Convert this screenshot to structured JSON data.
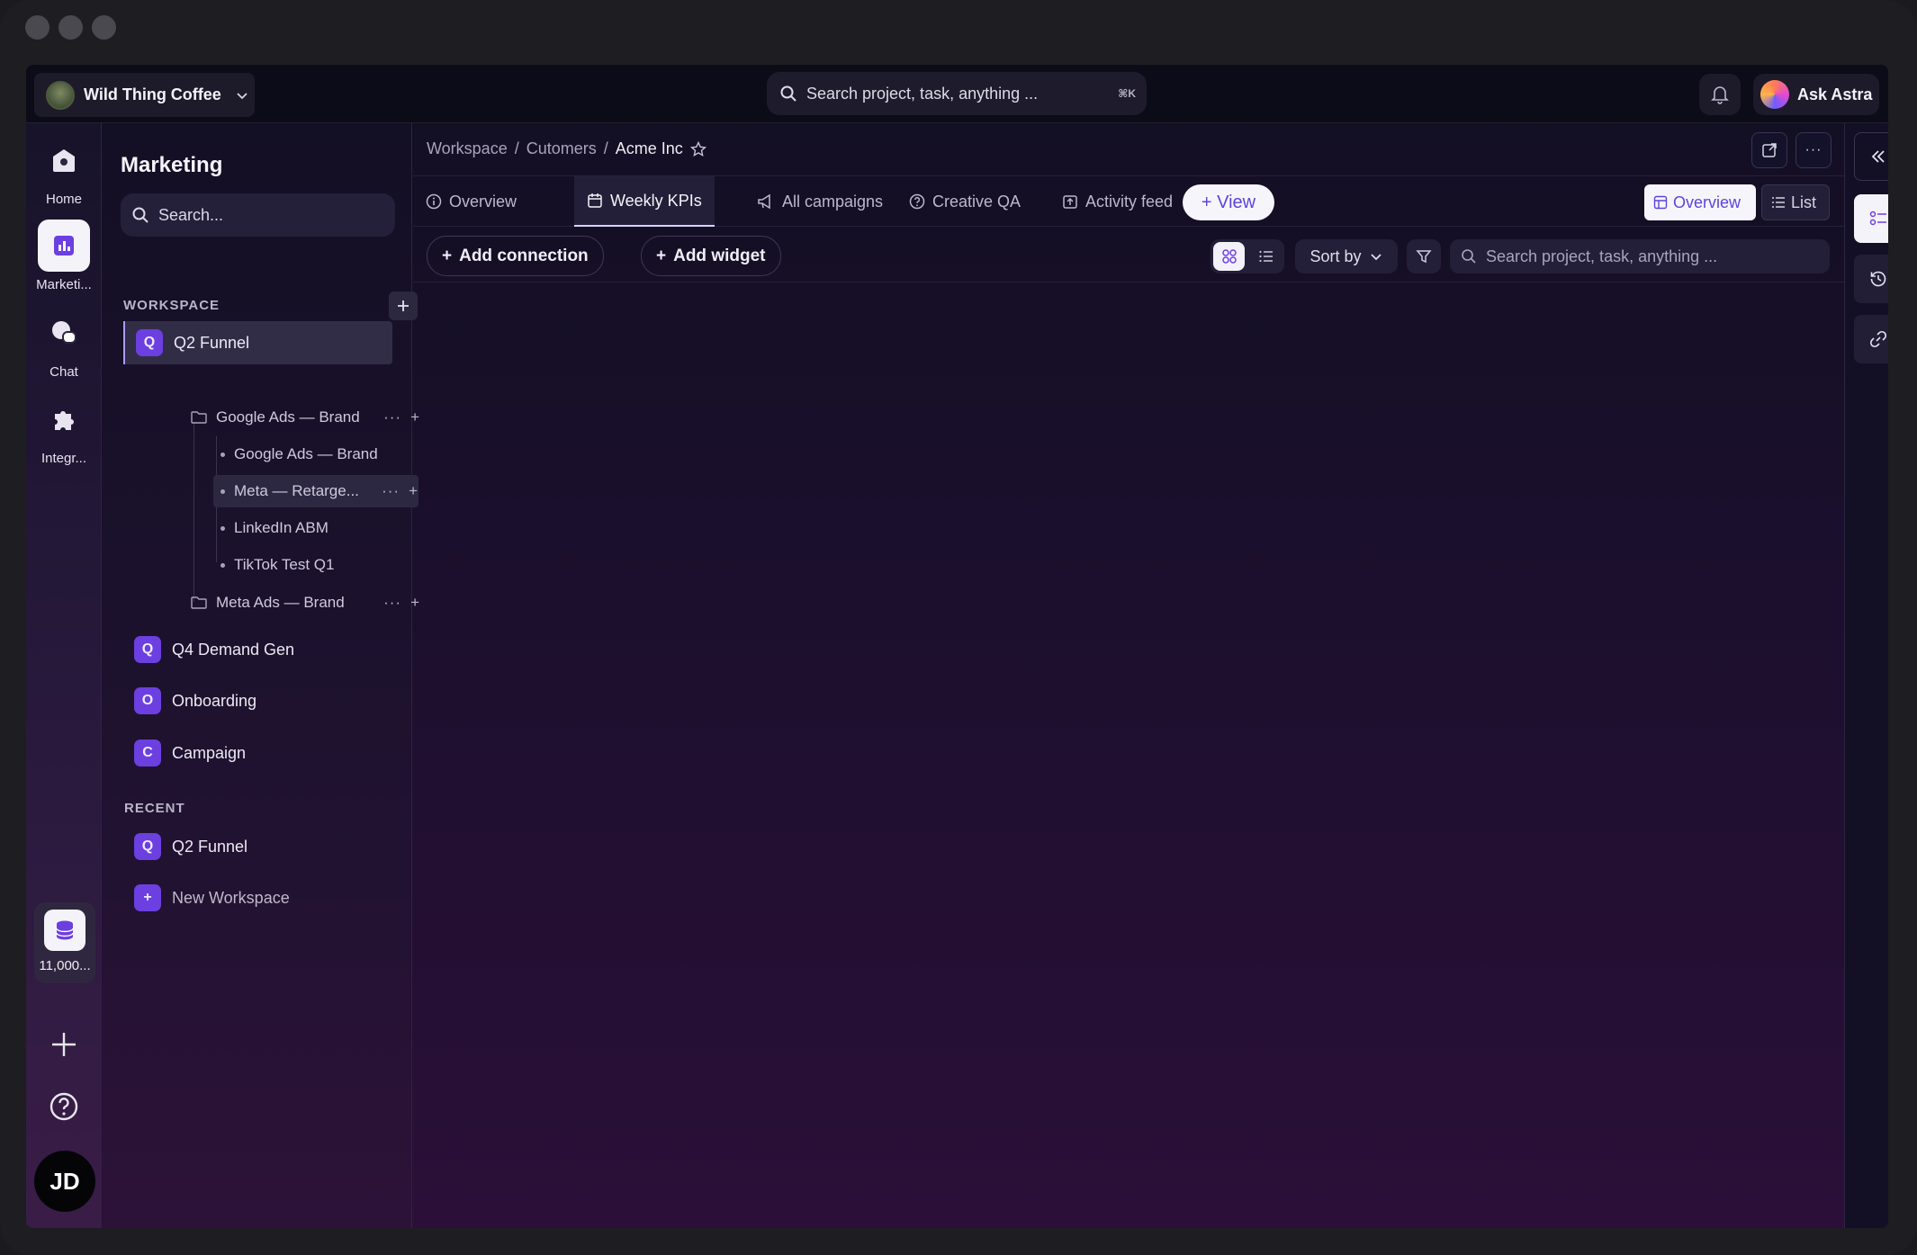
{
  "org": {
    "name": "Wild Thing Coffee"
  },
  "global_search": {
    "placeholder": "Search project, task, anything ...",
    "shortcut": "⌘K"
  },
  "assistant": {
    "label": "Ask Astra"
  },
  "rail": {
    "items": [
      {
        "label": "Home",
        "icon": "home-icon"
      },
      {
        "label": "Marketi...",
        "icon": "chart-icon",
        "active": true
      },
      {
        "label": "Chat",
        "icon": "chat-icon"
      },
      {
        "label": "Integr...",
        "icon": "puzzle-icon"
      }
    ],
    "credits": "11,000...",
    "user_initials": "JD"
  },
  "sidebar": {
    "title": "Marketing",
    "search_placeholder": "Search...",
    "workspace_label": "WORKSPACE",
    "recent_label": "RECENT",
    "workspaces": [
      {
        "badge": "Q",
        "label": "Q2 Funnel",
        "active": true
      },
      {
        "badge": "Q",
        "label": "Q4 Demand Gen"
      },
      {
        "badge": "O",
        "label": "Onboarding"
      },
      {
        "badge": "C",
        "label": "Campaign"
      }
    ],
    "folders": [
      {
        "label": "Google Ads — Brand"
      },
      {
        "label": "Meta Ads — Brand"
      }
    ],
    "leaves": [
      {
        "label": "Google Ads — Brand"
      },
      {
        "label": "Meta — Retarge..."
      },
      {
        "label": "LinkedIn ABM"
      },
      {
        "label": "TikTok Test Q1"
      }
    ],
    "recent": [
      {
        "badge": "Q",
        "label": "Q2 Funnel"
      },
      {
        "badge": "+",
        "label": "New Workspace"
      }
    ]
  },
  "breadcrumb": {
    "items": [
      "Workspace",
      "Cutomers",
      "Acme Inc"
    ]
  },
  "tabs": [
    {
      "label": "Overview",
      "icon": "info-icon"
    },
    {
      "label": "Weekly KPIs",
      "icon": "calendar-icon",
      "active": true
    },
    {
      "label": "All campaigns",
      "icon": "megaphone-icon"
    },
    {
      "label": "Creative QA",
      "icon": "question-icon"
    },
    {
      "label": "Activity feed",
      "icon": "upload-icon"
    }
  ],
  "view_button": "+ View",
  "view_toggle": {
    "overview": "Overview",
    "list": "List"
  },
  "toolbar": {
    "add_connection": "Add connection",
    "add_widget": "Add widget",
    "sort_by": "Sort by",
    "search_placeholder": "Search project, task, anything ..."
  },
  "colors": {
    "accent": "#6c3fe0",
    "accent_text": "#5a46d8"
  }
}
